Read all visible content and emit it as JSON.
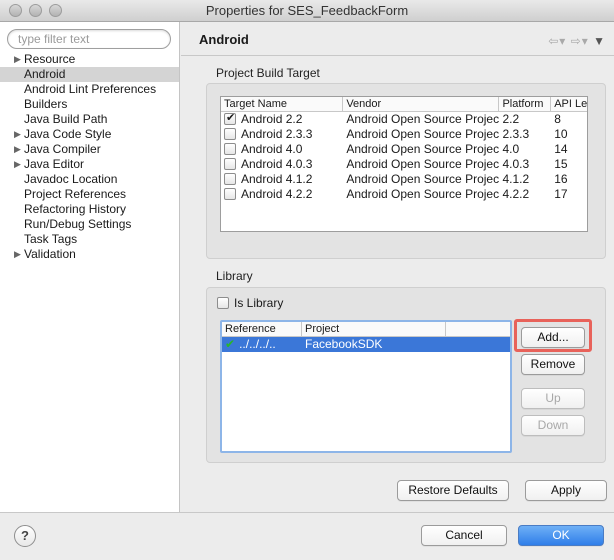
{
  "window": {
    "title": "Properties for SES_FeedbackForm"
  },
  "sidebar": {
    "filter_placeholder": "type filter text",
    "items": [
      {
        "label": "Resource",
        "expandable": true
      },
      {
        "label": "Android",
        "expandable": false,
        "selected": true
      },
      {
        "label": "Android Lint Preferences",
        "expandable": false
      },
      {
        "label": "Builders",
        "expandable": false
      },
      {
        "label": "Java Build Path",
        "expandable": false
      },
      {
        "label": "Java Code Style",
        "expandable": true
      },
      {
        "label": "Java Compiler",
        "expandable": true
      },
      {
        "label": "Java Editor",
        "expandable": true
      },
      {
        "label": "Javadoc Location",
        "expandable": false
      },
      {
        "label": "Project References",
        "expandable": false
      },
      {
        "label": "Refactoring History",
        "expandable": false
      },
      {
        "label": "Run/Debug Settings",
        "expandable": false
      },
      {
        "label": "Task Tags",
        "expandable": false
      },
      {
        "label": "Validation",
        "expandable": true
      }
    ]
  },
  "page": {
    "title": "Android",
    "nav": {
      "back": "⇦",
      "back_menu": "▾",
      "forward": "⇨",
      "forward_menu": "▾",
      "view_menu": "▼"
    }
  },
  "build_target": {
    "group_title": "Project Build Target",
    "columns": [
      "Target Name",
      "Vendor",
      "Platform",
      "API Le"
    ],
    "rows": [
      {
        "name": "Android 2.2",
        "vendor": "Android Open Source Project",
        "platform": "2.2",
        "api": "8",
        "checked": true
      },
      {
        "name": "Android 2.3.3",
        "vendor": "Android Open Source Project",
        "platform": "2.3.3",
        "api": "10",
        "checked": false
      },
      {
        "name": "Android 4.0",
        "vendor": "Android Open Source Project",
        "platform": "4.0",
        "api": "14",
        "checked": false
      },
      {
        "name": "Android 4.0.3",
        "vendor": "Android Open Source Project",
        "platform": "4.0.3",
        "api": "15",
        "checked": false
      },
      {
        "name": "Android 4.1.2",
        "vendor": "Android Open Source Project",
        "platform": "4.1.2",
        "api": "16",
        "checked": false
      },
      {
        "name": "Android 4.2.2",
        "vendor": "Android Open Source Project",
        "platform": "4.2.2",
        "api": "17",
        "checked": false
      }
    ]
  },
  "library": {
    "group_title": "Library",
    "is_library_label": "Is Library",
    "is_library_checked": false,
    "columns": [
      "Reference",
      "Project"
    ],
    "rows": [
      {
        "reference": "../../../..",
        "project": "FacebookSDK",
        "ok_mark": "✔",
        "selected": true
      }
    ],
    "buttons": {
      "add": "Add...",
      "remove": "Remove",
      "up": "Up",
      "down": "Down"
    }
  },
  "actions": {
    "restore_defaults": "Restore Defaults",
    "apply": "Apply"
  },
  "footer": {
    "help": "?",
    "cancel": "Cancel",
    "ok": "OK"
  },
  "colors": {
    "selection_blue": "#3b77d8",
    "highlight_red": "#e8625a",
    "ok_green": "#29b629"
  }
}
